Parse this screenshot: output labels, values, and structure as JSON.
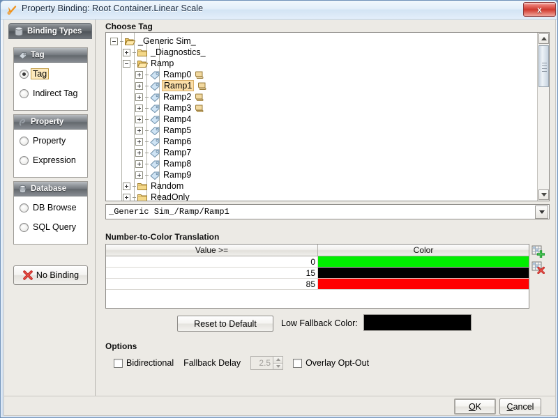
{
  "window": {
    "title": "Property Binding: Root Container.Linear Scale",
    "title_icon": "wrench-icon",
    "close_label": "x"
  },
  "sidebar": {
    "header": {
      "label": "Binding Types",
      "icon": "binding-types-icon"
    },
    "groups": [
      {
        "title": "Tag",
        "icon": "tag-icon",
        "options": [
          {
            "label": "Tag",
            "selected": true
          },
          {
            "label": "Indirect Tag",
            "selected": false
          }
        ]
      },
      {
        "title": "Property",
        "icon": "property-icon",
        "options": [
          {
            "label": "Property",
            "selected": false
          },
          {
            "label": "Expression",
            "selected": false
          }
        ]
      },
      {
        "title": "Database",
        "icon": "database-icon",
        "options": [
          {
            "label": "DB Browse",
            "selected": false
          },
          {
            "label": "SQL Query",
            "selected": false
          }
        ]
      }
    ],
    "no_binding": {
      "label": "No Binding",
      "icon": "red-x-icon"
    }
  },
  "main": {
    "choose_tag_label": "Choose Tag",
    "tree": [
      {
        "label": "_Generic Sim_",
        "depth": 1,
        "toggle": "minus",
        "icon": "folder-open-icon",
        "selected": false,
        "tag_icon": false
      },
      {
        "label": "_Diagnostics_",
        "depth": 2,
        "toggle": "plus",
        "icon": "folder-closed-icon",
        "selected": false,
        "tag_icon": false
      },
      {
        "label": "Ramp",
        "depth": 2,
        "toggle": "minus",
        "icon": "folder-open-icon",
        "selected": false,
        "tag_icon": false
      },
      {
        "label": "Ramp0",
        "depth": 3,
        "toggle": "plus",
        "icon": "tag-leaf-icon",
        "selected": false,
        "tag_icon": true
      },
      {
        "label": "Ramp1",
        "depth": 3,
        "toggle": "plus",
        "icon": "tag-leaf-icon",
        "selected": true,
        "tag_icon": true
      },
      {
        "label": "Ramp2",
        "depth": 3,
        "toggle": "plus",
        "icon": "tag-leaf-icon",
        "selected": false,
        "tag_icon": true
      },
      {
        "label": "Ramp3",
        "depth": 3,
        "toggle": "plus",
        "icon": "tag-leaf-icon",
        "selected": false,
        "tag_icon": true
      },
      {
        "label": "Ramp4",
        "depth": 3,
        "toggle": "plus",
        "icon": "tag-leaf-icon",
        "selected": false,
        "tag_icon": false
      },
      {
        "label": "Ramp5",
        "depth": 3,
        "toggle": "plus",
        "icon": "tag-leaf-icon",
        "selected": false,
        "tag_icon": false
      },
      {
        "label": "Ramp6",
        "depth": 3,
        "toggle": "plus",
        "icon": "tag-leaf-icon",
        "selected": false,
        "tag_icon": false
      },
      {
        "label": "Ramp7",
        "depth": 3,
        "toggle": "plus",
        "icon": "tag-leaf-icon",
        "selected": false,
        "tag_icon": false
      },
      {
        "label": "Ramp8",
        "depth": 3,
        "toggle": "plus",
        "icon": "tag-leaf-icon",
        "selected": false,
        "tag_icon": false
      },
      {
        "label": "Ramp9",
        "depth": 3,
        "toggle": "plus",
        "icon": "tag-leaf-icon",
        "selected": false,
        "tag_icon": false
      },
      {
        "label": "Random",
        "depth": 2,
        "toggle": "plus",
        "icon": "folder-closed-icon",
        "selected": false,
        "tag_icon": false
      },
      {
        "label": "ReadOnly",
        "depth": 2,
        "toggle": "plus",
        "icon": "folder-closed-icon",
        "selected": false,
        "tag_icon": false
      }
    ],
    "path_field": {
      "value": "_Generic Sim_/Ramp/Ramp1",
      "dropdown_icon": "chevron-down-icon"
    },
    "translation": {
      "section_label": "Number-to-Color Translation",
      "columns": [
        "Value >=",
        "Color"
      ],
      "rows": [
        {
          "value": "0",
          "color": "#00ee00"
        },
        {
          "value": "15",
          "color": "#000000"
        },
        {
          "value": "85",
          "color": "#ff0000"
        }
      ],
      "add_row_icon": "table-add-row-icon",
      "delete_row_icon": "table-delete-row-icon"
    },
    "reset_button": "Reset to Default",
    "low_fallback": {
      "label": "Low Fallback Color:",
      "color": "#000000"
    },
    "options": {
      "section_label": "Options",
      "bidirectional": {
        "label": "Bidirectional",
        "checked": false
      },
      "fallback_delay": {
        "label": "Fallback Delay",
        "value": "2.5",
        "enabled": false
      },
      "overlay_opt_out": {
        "label": "Overlay Opt-Out",
        "checked": false
      }
    }
  },
  "footer": {
    "ok": {
      "pre": "",
      "mnemonic": "O",
      "post": "K"
    },
    "cancel": {
      "pre": "",
      "mnemonic": "C",
      "post": "ancel"
    }
  }
}
